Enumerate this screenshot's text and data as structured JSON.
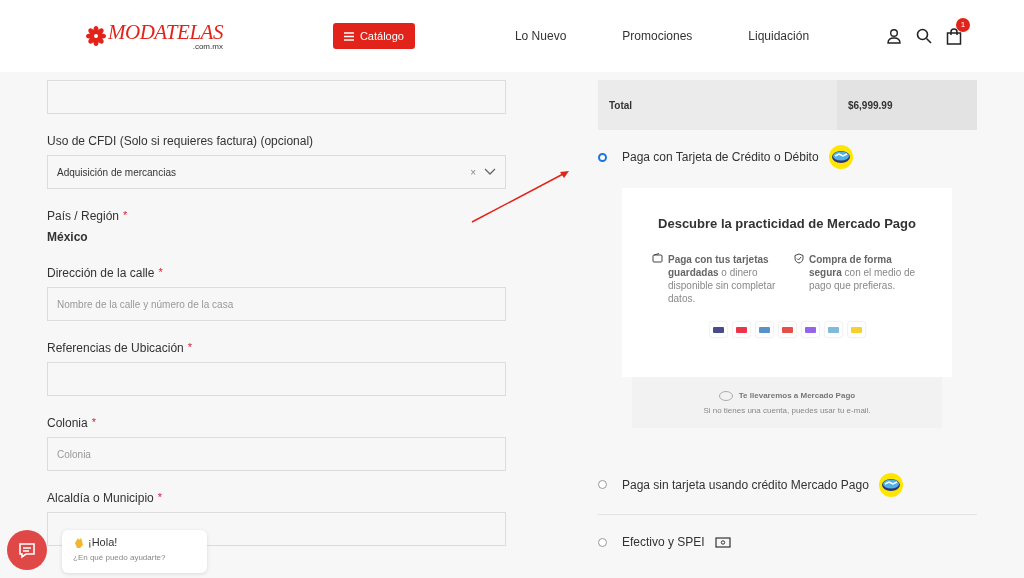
{
  "header": {
    "logo": "MODATELAS",
    "logo_sub": ".com.mx",
    "catalog_button": "Catálogo",
    "nav": [
      "Lo Nuevo",
      "Promociones",
      "Liquidación"
    ],
    "cart_count": "1"
  },
  "form": [
    {
      "kind": "input"
    },
    {
      "kind": "select",
      "label": "Uso de CFDI (Solo si requieres factura) (opcional)",
      "value": "Adquisición de mercancias",
      "clear": "×"
    },
    {
      "kind": "static",
      "label": "País / Región",
      "required_mark": "*",
      "value": "México"
    },
    {
      "kind": "input",
      "label": "Dirección de la calle",
      "required_mark": "*",
      "placeholder": "Nombre de la calle y número de la casa"
    },
    {
      "kind": "input",
      "label": "Referencias de Ubicación",
      "required_mark": "*"
    },
    {
      "kind": "input",
      "label": "Colonia",
      "required_mark": "*",
      "placeholder": "Colonia"
    },
    {
      "kind": "input",
      "label": "Alcaldía o Municipio",
      "required_mark": "*"
    }
  ],
  "order_total": {
    "label": "Total",
    "value": "$6,999.99"
  },
  "payment_methods": [
    {
      "label": "Paga con Tarjeta de Crédito o Débito",
      "selected": true,
      "kind": "mercadopago"
    },
    {
      "label": "Paga sin tarjeta usando crédito Mercado Pago",
      "selected": false,
      "kind": "mercadopago"
    },
    {
      "label": "Efectivo y SPEI",
      "selected": false,
      "kind": "cash"
    }
  ],
  "promo": {
    "title": "Descubre la practicidad de Mercado Pago",
    "benefits": [
      {
        "text": "**Paga con tus tarjetas guardadas** o dinero disponible sin completar datos.",
        "kind": "wallet"
      },
      {
        "text": "**Compra de forma segura** con el medio de pago que prefieras.",
        "kind": "shield"
      }
    ],
    "redirect_title": "Te llevaremos a Mercado Pago",
    "redirect_note": "Si no tienes una cuenta, puedes usar tu e-mail."
  },
  "chat": {
    "greeting": "¡Hola!",
    "prompt": "¿En qué puedo ayudarte?"
  }
}
